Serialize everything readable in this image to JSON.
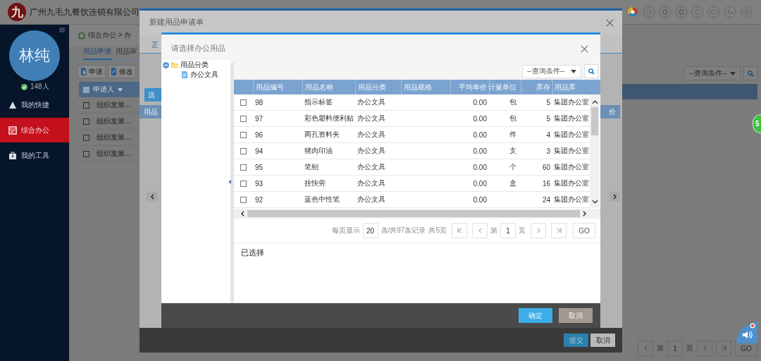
{
  "header": {
    "logo": "九",
    "company": "广州九毛九餐饮连锁有限公司"
  },
  "sidebar": {
    "avatar": "林纯",
    "online_count": "148人",
    "items": [
      {
        "label": "我的快捷",
        "selected": false
      },
      {
        "label": "综合办公",
        "selected": true
      },
      {
        "label": "我的工具",
        "selected": false
      }
    ]
  },
  "breadcrumb": "综合办公 > 办",
  "tabs": [
    {
      "label": "用品申请",
      "selected": true
    },
    {
      "label": "用品审",
      "selected": false
    }
  ],
  "toolbar": [
    "申请",
    "修改"
  ],
  "table": {
    "columns": [
      "申请人"
    ],
    "select_all_checked": false,
    "rows": [
      {
        "checked": false,
        "applicant": "组织发展..."
      },
      {
        "checked": false,
        "applicant": "组织发展..."
      },
      {
        "checked": false,
        "applicant": "组织发展..."
      },
      {
        "checked": false,
        "applicant": "组织发展..."
      }
    ]
  },
  "search": {
    "placeholder": "--查询条件--"
  },
  "pagination": {
    "page_label": "第",
    "page": "1",
    "page_suffix": "页",
    "go": "GO"
  },
  "notification_badge": "5",
  "request_dialog": {
    "title": "新建用品申请单",
    "tabs": [
      {
        "label": "正",
        "selected": true
      }
    ],
    "select_button": "选",
    "columns": [
      "用品",
      "价"
    ],
    "buttons": [
      {
        "label": "提交",
        "kind": "primary"
      },
      {
        "label": "取消",
        "kind": "secondary"
      }
    ]
  },
  "picker_dialog": {
    "title": "请选择办公用品",
    "tree": [
      {
        "label": "用品分类",
        "expanded": true,
        "children": [
          {
            "label": "办公文具"
          }
        ]
      }
    ],
    "search": {
      "placeholder": "--查询条件--"
    },
    "table": {
      "columns": [
        "用品编号",
        "用品名称",
        "用品分类",
        "用品规格",
        "平均单价",
        "计量单位",
        "库存",
        "用品库"
      ],
      "rows": [
        {
          "checked": false,
          "id": "98",
          "name": "指示标签",
          "category": "办公文具",
          "price": "0.00",
          "unit": "包",
          "stock": "5",
          "store": "集团办公室"
        },
        {
          "checked": false,
          "id": "97",
          "name": "彩色塑料便利贴",
          "category": "办公文具",
          "price": "0.00",
          "unit": "包",
          "stock": "5",
          "store": "集团办公室"
        },
        {
          "checked": false,
          "id": "96",
          "name": "两孔资料夹",
          "category": "办公文具",
          "price": "0.00",
          "unit": "件",
          "stock": "4",
          "store": "集团办公室"
        },
        {
          "checked": false,
          "id": "94",
          "name": "猪肉印油",
          "category": "办公文具",
          "price": "0.00",
          "unit": "支",
          "stock": "3",
          "store": "集团办公室"
        },
        {
          "checked": false,
          "id": "95",
          "name": "笔刨",
          "category": "办公文具",
          "price": "0.00",
          "unit": "个",
          "stock": "60",
          "store": "集团办公室"
        },
        {
          "checked": false,
          "id": "93",
          "name": "挂快劳",
          "category": "办公文具",
          "price": "0.00",
          "unit": "盒",
          "stock": "16",
          "store": "集团办公室"
        },
        {
          "checked": false,
          "id": "92",
          "name": "蓝色中性笔",
          "category": "办公文具",
          "price": "0.00",
          "stock": "24",
          "store": "集团办公室"
        }
      ]
    },
    "pagination": {
      "per_page_label": "每页显示",
      "per_page": "20",
      "records_label": "条/共97条记录",
      "pages_label": "共5页",
      "page_label": "第",
      "page": "1",
      "page_suffix": "页",
      "go": "GO"
    },
    "selected_label": "已选择",
    "buttons": [
      {
        "label": "确定",
        "kind": "primary"
      },
      {
        "label": "取消",
        "kind": "secondary"
      }
    ]
  }
}
